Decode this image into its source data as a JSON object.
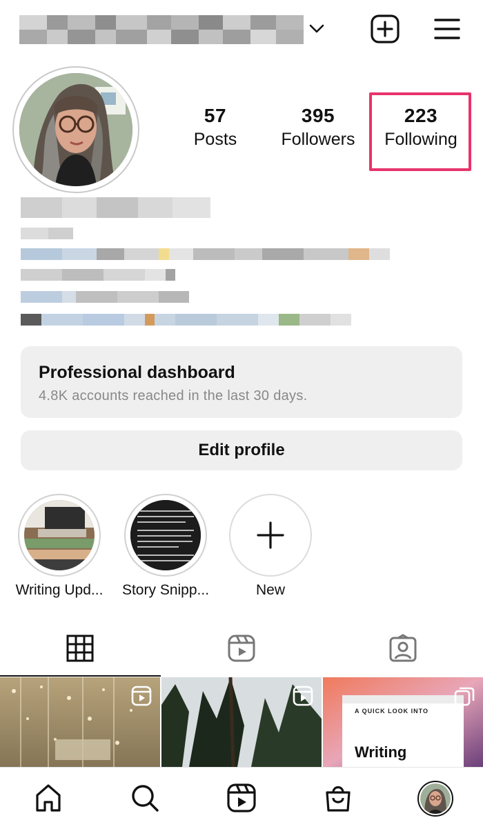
{
  "header": {
    "username_obscured": true
  },
  "profile": {
    "stats": [
      {
        "value": "57",
        "label": "Posts"
      },
      {
        "value": "395",
        "label": "Followers"
      },
      {
        "value": "223",
        "label": "Following"
      }
    ],
    "highlighted_stat": "Following",
    "highlight_color": "#e8336b"
  },
  "dashboard": {
    "title": "Professional dashboard",
    "subtitle": "4.8K accounts reached in the last 30 days."
  },
  "edit_profile": {
    "label": "Edit profile"
  },
  "story_highlights": [
    {
      "label": "Writing Upd..."
    },
    {
      "label": "Story Snipp..."
    },
    {
      "label": "New"
    }
  ],
  "tabs": [
    {
      "name": "grid-tab",
      "icon": "grid-icon",
      "active": true
    },
    {
      "name": "reels-tab",
      "icon": "reels-icon",
      "active": false
    },
    {
      "name": "tagged-tab",
      "icon": "tagged-user-icon",
      "active": false
    }
  ],
  "posts": [
    {
      "type": "reel",
      "icon": "reel-icon"
    },
    {
      "type": "reel",
      "icon": "reel-icon"
    },
    {
      "type": "carousel",
      "icon": "carousel-icon",
      "overlay_text_small": "A QUICK LOOK INTO",
      "overlay_text_big": "Writing"
    }
  ],
  "bottom_nav": [
    {
      "name": "nav-home",
      "icon": "home-icon"
    },
    {
      "name": "nav-search",
      "icon": "search-icon"
    },
    {
      "name": "nav-reels",
      "icon": "reels-icon"
    },
    {
      "name": "nav-shop",
      "icon": "shop-bag-icon"
    },
    {
      "name": "nav-profile",
      "icon": "profile-avatar"
    }
  ]
}
